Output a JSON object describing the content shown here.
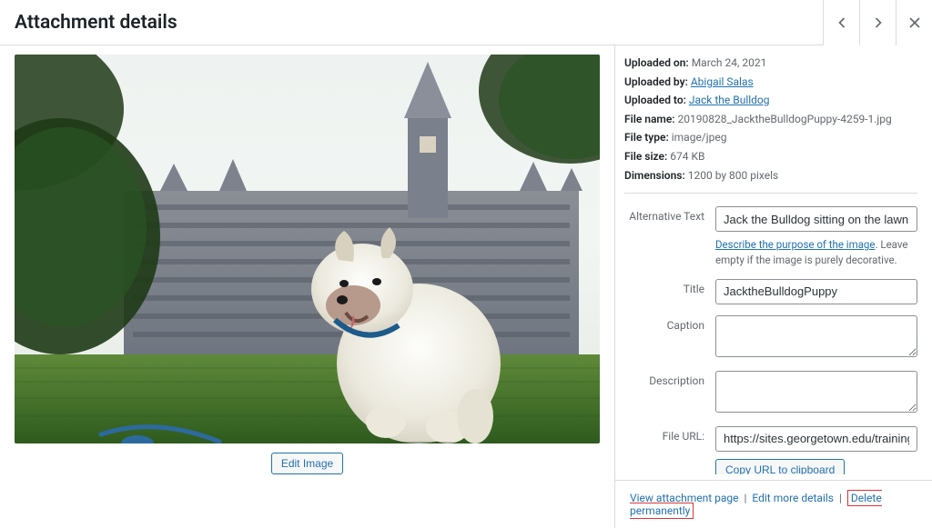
{
  "header": {
    "title": "Attachment details"
  },
  "preview": {
    "edit_button_label": "Edit Image"
  },
  "meta": {
    "uploaded_on_label": "Uploaded on:",
    "uploaded_on_value": "March 24, 2021",
    "uploaded_by_label": "Uploaded by:",
    "uploaded_by_value": "Abigail Salas",
    "uploaded_to_label": "Uploaded to:",
    "uploaded_to_value": "Jack the Bulldog",
    "file_name_label": "File name:",
    "file_name_value": "20190828_JacktheBulldogPuppy-4259-1.jpg",
    "file_type_label": "File type:",
    "file_type_value": "image/jpeg",
    "file_size_label": "File size:",
    "file_size_value": "674 KB",
    "dimensions_label": "Dimensions:",
    "dimensions_value": "1200 by 800 pixels"
  },
  "fields": {
    "alt_text": {
      "label": "Alternative Text",
      "value": "Jack the Bulldog sitting on the lawn in front of Healy Hall",
      "help_link": "Describe the purpose of the image",
      "help_rest": ". Leave empty if the image is purely decorative."
    },
    "title": {
      "label": "Title",
      "value": "JacktheBulldogPuppy"
    },
    "caption": {
      "label": "Caption",
      "value": ""
    },
    "description": {
      "label": "Description",
      "value": ""
    },
    "file_url": {
      "label": "File URL:",
      "value": "https://sites.georgetown.edu/training/wp-content/uploads/sites/...",
      "copy_label": "Copy URL to clipboard"
    }
  },
  "footer": {
    "view_label": "View attachment page",
    "edit_label": "Edit more details",
    "delete_label": "Delete permanently"
  }
}
